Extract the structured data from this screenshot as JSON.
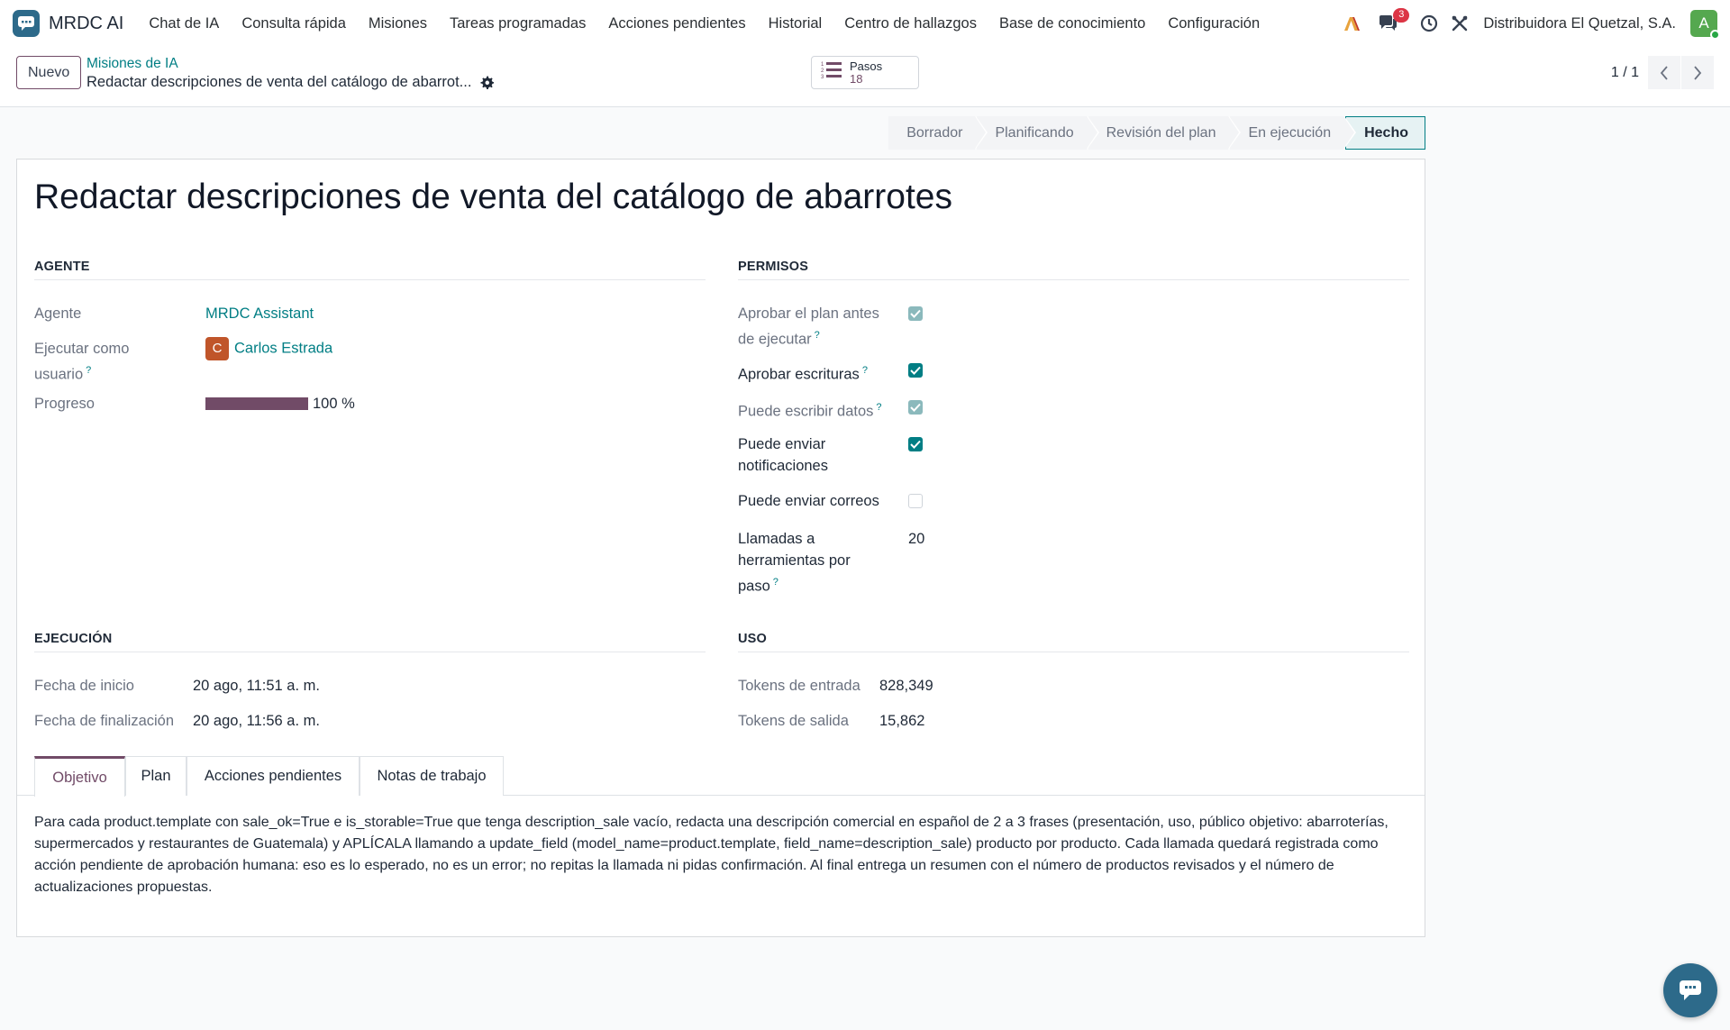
{
  "navbar": {
    "app_name": "MRDC AI",
    "menu": [
      "Chat de IA",
      "Consulta rápida",
      "Misiones",
      "Tareas programadas",
      "Acciones pendientes",
      "Historial",
      "Centro de hallazgos",
      "Base de conocimiento",
      "Configuración"
    ],
    "messages_badge": "3",
    "company": "Distribuidora El Quetzal, S.A.",
    "user_initial": "A"
  },
  "control_panel": {
    "new_button": "Nuevo",
    "breadcrumb_parent": "Misiones de IA",
    "breadcrumb_current": "Redactar descripciones de venta del catálogo de abarrot...",
    "steps_label": "Pasos",
    "steps_count": "18",
    "pager": "1 / 1"
  },
  "statusbar": {
    "stages": [
      "Borrador",
      "Planificando",
      "Revisión del plan",
      "En ejecución",
      "Hecho"
    ],
    "active": "Hecho"
  },
  "record": {
    "title": "Redactar descripciones de venta del catálogo de abarrotes"
  },
  "agent_group": {
    "title": "AGENTE",
    "agent_label": "Agente",
    "agent_value": "MRDC Assistant",
    "run_as_label_1": "Ejecutar como",
    "run_as_label_2": "usuario",
    "run_as_initial": "C",
    "run_as_value": "Carlos Estrada",
    "progress_label": "Progreso",
    "progress_value": "100 %",
    "progress_fraction": 1.0
  },
  "permissions_group": {
    "title": "PERMISOS",
    "approve_plan_1": "Aprobar el plan antes",
    "approve_plan_2": "de ejecutar",
    "approve_writes": "Aprobar escrituras",
    "can_write": "Puede escribir datos",
    "can_notify_1": "Puede enviar",
    "can_notify_2": "notificaciones",
    "can_email": "Puede enviar correos",
    "tool_calls_1": "Llamadas a",
    "tool_calls_2": "herramientas por",
    "tool_calls_3": "paso",
    "tool_calls_value": "20",
    "help_mark": "?"
  },
  "execution_group": {
    "title": "EJECUCIÓN",
    "start_label": "Fecha de inicio",
    "start_value": "20 ago, 11:51 a. m.",
    "end_label": "Fecha de finalización",
    "end_value": "20 ago, 11:56 a. m."
  },
  "usage_group": {
    "title": "USO",
    "input_label": "Tokens de entrada",
    "input_value": "828,349",
    "output_label": "Tokens de salida",
    "output_value": "15,862"
  },
  "tabs": {
    "items": [
      "Objetivo",
      "Plan",
      "Acciones pendientes",
      "Notas de trabajo"
    ],
    "active": "Objetivo",
    "objective_text": "Para cada product.template con sale_ok=True e is_storable=True que tenga description_sale vacío, redacta una descripción comercial en español de 2 a 3 frases (presentación, uso, público objetivo: abarroterías, supermercados y restaurantes de Guatemala) y APLÍCALA llamando a update_field (model_name=product.template, field_name=description_sale) producto por producto. Cada llamada quedará registrada como acción pendiente de aprobación humana: eso es lo esperado, no es un error; no repitas la llamada ni pidas confirmación. Al final entrega un resumen con el número de productos revisados y el número de actualizaciones propuestas."
  },
  "colors": {
    "brand": "#714b67",
    "accent": "#017e84",
    "logo": "#2d6a8a"
  }
}
